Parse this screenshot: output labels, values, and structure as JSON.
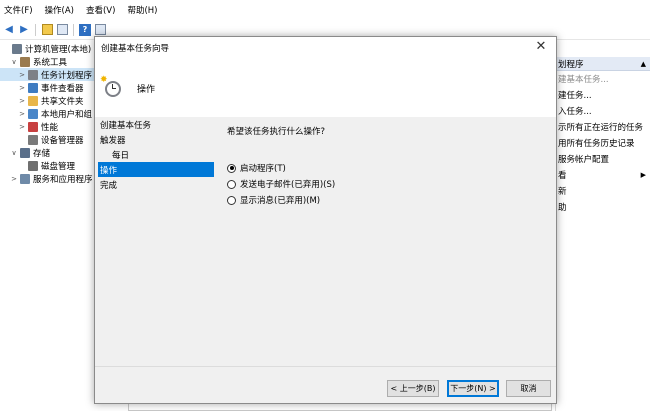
{
  "menu": [
    "文件(F)",
    "操作(A)",
    "查看(V)",
    "帮助(H)"
  ],
  "toolbar": {
    "back": "◀",
    "forward": "▶",
    "help": "?"
  },
  "tree": [
    {
      "label": "计算机管理(本地)",
      "indent": 0,
      "chev": "",
      "icon": "computer-icon",
      "color": "#6a7a8c"
    },
    {
      "label": "系统工具",
      "indent": 1,
      "chev": "∨",
      "icon": "tools-icon",
      "color": "#9a7b4f"
    },
    {
      "label": "任务计划程序",
      "indent": 2,
      "chev": ">",
      "icon": "clock-icon",
      "color": "#7d8087",
      "selected": true
    },
    {
      "label": "事件查看器",
      "indent": 2,
      "chev": ">",
      "icon": "event-viewer-icon",
      "color": "#3e7cc2"
    },
    {
      "label": "共享文件夹",
      "indent": 2,
      "chev": ">",
      "icon": "shared-folder-icon",
      "color": "#e8b64a"
    },
    {
      "label": "本地用户和组",
      "indent": 2,
      "chev": ">",
      "icon": "users-icon",
      "color": "#4a86c8"
    },
    {
      "label": "性能",
      "indent": 2,
      "chev": ">",
      "icon": "performance-icon",
      "color": "#c84040"
    },
    {
      "label": "设备管理器",
      "indent": 2,
      "chev": "",
      "icon": "device-manager-icon",
      "color": "#7a7a7a"
    },
    {
      "label": "存储",
      "indent": 1,
      "chev": "∨",
      "icon": "storage-icon",
      "color": "#5a6f8a"
    },
    {
      "label": "磁盘管理",
      "indent": 2,
      "chev": "",
      "icon": "disk-icon",
      "color": "#6f6f6f"
    },
    {
      "label": "服务和应用程序",
      "indent": 1,
      "chev": ">",
      "icon": "services-icon",
      "color": "#6f8aa8"
    }
  ],
  "actions": {
    "header": "划程序",
    "items": [
      {
        "label": "建基本任务...",
        "grey": true
      },
      {
        "label": "建任务..."
      },
      {
        "label": "入任务..."
      },
      {
        "label": "示所有正在运行的任务"
      },
      {
        "label": "用所有任务历史记录"
      },
      {
        "label": "服务帐户配置"
      },
      {
        "label": "看",
        "arrow": "▶"
      },
      {
        "label": "新"
      },
      {
        "label": "助"
      }
    ]
  },
  "dialog": {
    "title": "创建基本任务向导",
    "close": "✕",
    "header_title": "操作",
    "steps": [
      {
        "label": "创建基本任务",
        "sub": false
      },
      {
        "label": "触发器",
        "sub": false
      },
      {
        "label": "每日",
        "sub": true
      },
      {
        "label": "操作",
        "sub": false,
        "active": true
      },
      {
        "label": "完成",
        "sub": false
      }
    ],
    "question": "希望该任务执行什么操作?",
    "options": [
      {
        "label": "启动程序(T)",
        "checked": true
      },
      {
        "label": "发送电子邮件(已弃用)(S)",
        "checked": false
      },
      {
        "label": "显示消息(已弃用)(M)",
        "checked": false
      }
    ],
    "buttons": {
      "back": "< 上一步(B)",
      "next": "下一步(N) >",
      "cancel": "取消"
    }
  },
  "accent": "#0078d7"
}
